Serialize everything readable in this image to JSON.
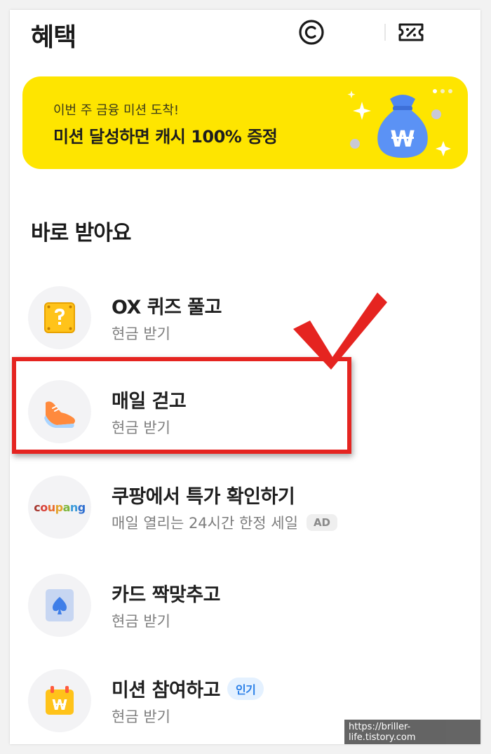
{
  "header": {
    "title": "혜택",
    "icons": [
      "copyright-icon",
      "coupon-ticket-icon"
    ]
  },
  "banner": {
    "subtitle": "이번 주 금융 미션 도착!",
    "title": "미션 달성하면 캐시 100% 증정",
    "money_bag_symbol": "W"
  },
  "section": {
    "title": "바로 받아요"
  },
  "items": [
    {
      "title": "OX 퀴즈 풀고",
      "subtitle": "현금 받기",
      "icon": "quiz-box-icon"
    },
    {
      "title": "매일 걷고",
      "subtitle": "현금 받기",
      "icon": "sneaker-icon"
    },
    {
      "title": "쿠팡에서 특가 확인하기",
      "subtitle": "매일 열리는 24시간 한정 세일",
      "badge": "AD",
      "icon": "coupang-logo",
      "logo_text": "coupang"
    },
    {
      "title": "카드 짝맞추고",
      "subtitle": "현금 받기",
      "icon": "spade-card-icon"
    },
    {
      "title": "미션 참여하고",
      "subtitle": "현금 받기",
      "badge": "인기",
      "icon": "calendar-won-icon",
      "symbol": "W"
    }
  ],
  "watermark": "https://briller-life.tistory.com",
  "colors": {
    "banner": "#fee500",
    "highlight": "#e52420",
    "popular_badge": "#2b80e8"
  }
}
